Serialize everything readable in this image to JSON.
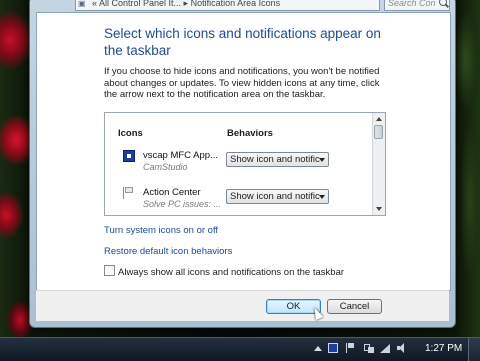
{
  "address_bar": {
    "text": "« All Control Panel It... ▸ Notification Area Icons"
  },
  "search": {
    "placeholder": "Search Con"
  },
  "page": {
    "title": "Select which icons and notifications appear on the taskbar",
    "description": "If you choose to hide icons and notifications, you won't be notified about changes or updates. To view hidden icons at any time, click the arrow next to the notification area on the taskbar."
  },
  "list": {
    "col_icons": "Icons",
    "col_behaviors": "Behaviors",
    "items": [
      {
        "name": "vscap MFC App...",
        "subtitle": "CamStudio",
        "behavior": "Show icon and notific",
        "icon": "vscap-icon"
      },
      {
        "name": "Action Center",
        "subtitle": "Solve PC issues: ...",
        "behavior": "Show icon and notific",
        "icon": "flag-icon"
      }
    ]
  },
  "links": {
    "system_icons": "Turn system icons on or off",
    "restore": "Restore default icon behaviors"
  },
  "checkbox": {
    "label": "Always show all icons and notifications on the taskbar",
    "checked": false
  },
  "buttons": {
    "ok": "OK",
    "cancel": "Cancel"
  },
  "taskbar": {
    "clock": "1:27 PM"
  },
  "colors": {
    "title_blue": "#1f4b8f",
    "taskbar": "#0f1823"
  }
}
